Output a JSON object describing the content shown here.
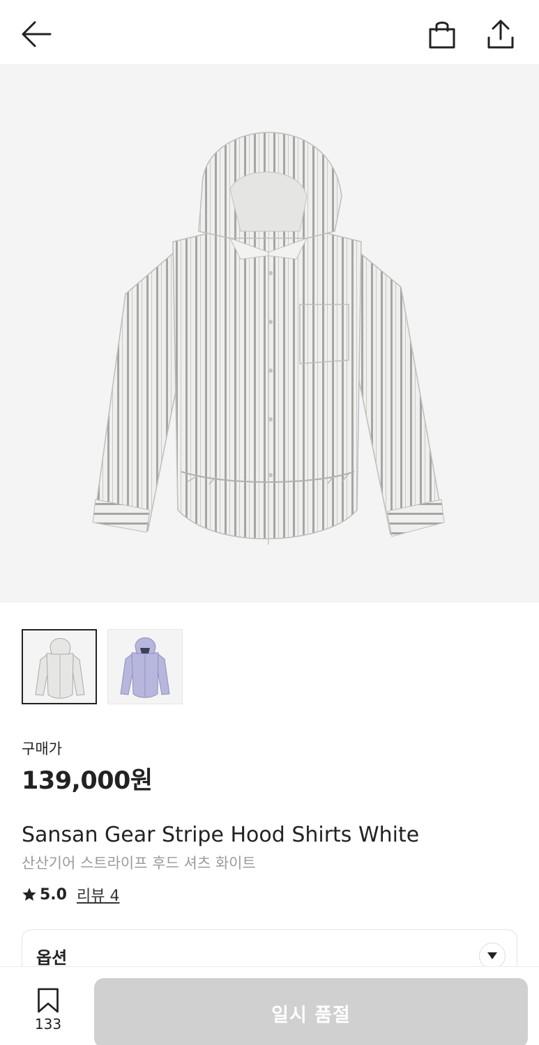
{
  "header": {
    "back_icon": "arrow-left-icon",
    "bag_icon": "shopping-bag-icon",
    "share_icon": "share-icon"
  },
  "product": {
    "image_colors": [
      "#ededeb",
      "#b7b4c9"
    ],
    "thumbnails": [
      {
        "name": "white",
        "color": "#e8e8e6",
        "stripe": "#9e9e9e",
        "selected": true
      },
      {
        "name": "blue",
        "color": "#b8b8dd",
        "stripe": "#8d8dc5",
        "selected": false
      }
    ],
    "price_label": "구매가",
    "price": "139,000원",
    "name_en": "Sansan Gear Stripe Hood Shirts White",
    "name_ko": "산산기어 스트라이프 후드 셔츠 화이트",
    "rating": "5.0",
    "review_text": "리뷰 4"
  },
  "options": {
    "label": "옵션"
  },
  "bottom": {
    "bookmark_count": "133",
    "cta_label": "일시 품절"
  },
  "colors": {
    "cta_disabled": "#d0d0d0",
    "text_primary": "#222222",
    "text_secondary": "#9a9a9a"
  }
}
